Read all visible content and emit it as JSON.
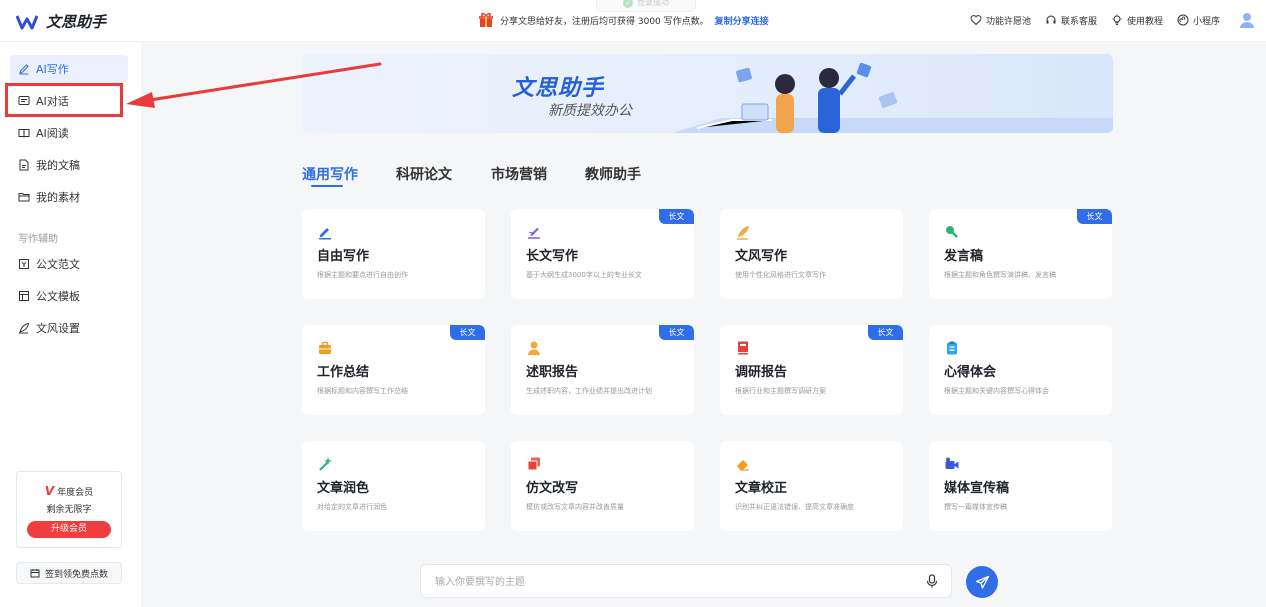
{
  "app": {
    "name": "文思助手"
  },
  "toast": {
    "text": "登录成功"
  },
  "notice": {
    "text": "分享文思给好友，注册后均可获得 3000 写作点数。",
    "link": "复制分享连接"
  },
  "top_right": {
    "items": [
      "功能许愿池",
      "联系客服",
      "使用教程",
      "小程序"
    ]
  },
  "sidebar": {
    "items": [
      "AI写作",
      "AI对话",
      "AI阅读",
      "我的文稿",
      "我的素材"
    ],
    "group_label": "写作辅助",
    "tools": [
      "公文范文",
      "公文模板",
      "文风设置"
    ],
    "member": {
      "type": "年度会员",
      "remaining": "剩余无限字",
      "upgrade": "升级会员"
    },
    "signin": "签到领免费点数"
  },
  "banner": {
    "title": "文思助手",
    "subtitle": "新质提效办公"
  },
  "tabs": [
    "通用写作",
    "科研论文",
    "市场营销",
    "教师助手"
  ],
  "cards": [
    {
      "title": "自由写作",
      "desc": "根据主题和要点进行自由创作",
      "tag": ""
    },
    {
      "title": "长文写作",
      "desc": "基于大纲生成3000字以上的专业长文",
      "tag": "长文"
    },
    {
      "title": "文风写作",
      "desc": "使用个性化风格进行文章写作",
      "tag": ""
    },
    {
      "title": "发言稿",
      "desc": "根据主题和角色撰写演讲稿、发言稿",
      "tag": "长文"
    },
    {
      "title": "工作总结",
      "desc": "根据标题和内容撰写工作总结",
      "tag": "长文"
    },
    {
      "title": "述职报告",
      "desc": "生成述职内容，工作业绩并提出改进计划",
      "tag": "长文"
    },
    {
      "title": "调研报告",
      "desc": "根据行业和主题撰写调研方案",
      "tag": "长文"
    },
    {
      "title": "心得体会",
      "desc": "根据主题和关键内容撰写心得体会",
      "tag": ""
    },
    {
      "title": "文章润色",
      "desc": "对给定的文章进行润色",
      "tag": ""
    },
    {
      "title": "仿文改写",
      "desc": "模仿或改写文章内容并改善质量",
      "tag": ""
    },
    {
      "title": "文章校正",
      "desc": "识别并纠正语法错误、提高文章准确度",
      "tag": ""
    },
    {
      "title": "媒体宣传稿",
      "desc": "撰写一篇媒体宣传稿",
      "tag": ""
    }
  ],
  "input": {
    "placeholder": "输入你要撰写的主题"
  },
  "colors": {
    "accent": "#2f6de9",
    "highlight": "#e83b3b",
    "upgrade": "#f03d3d"
  }
}
